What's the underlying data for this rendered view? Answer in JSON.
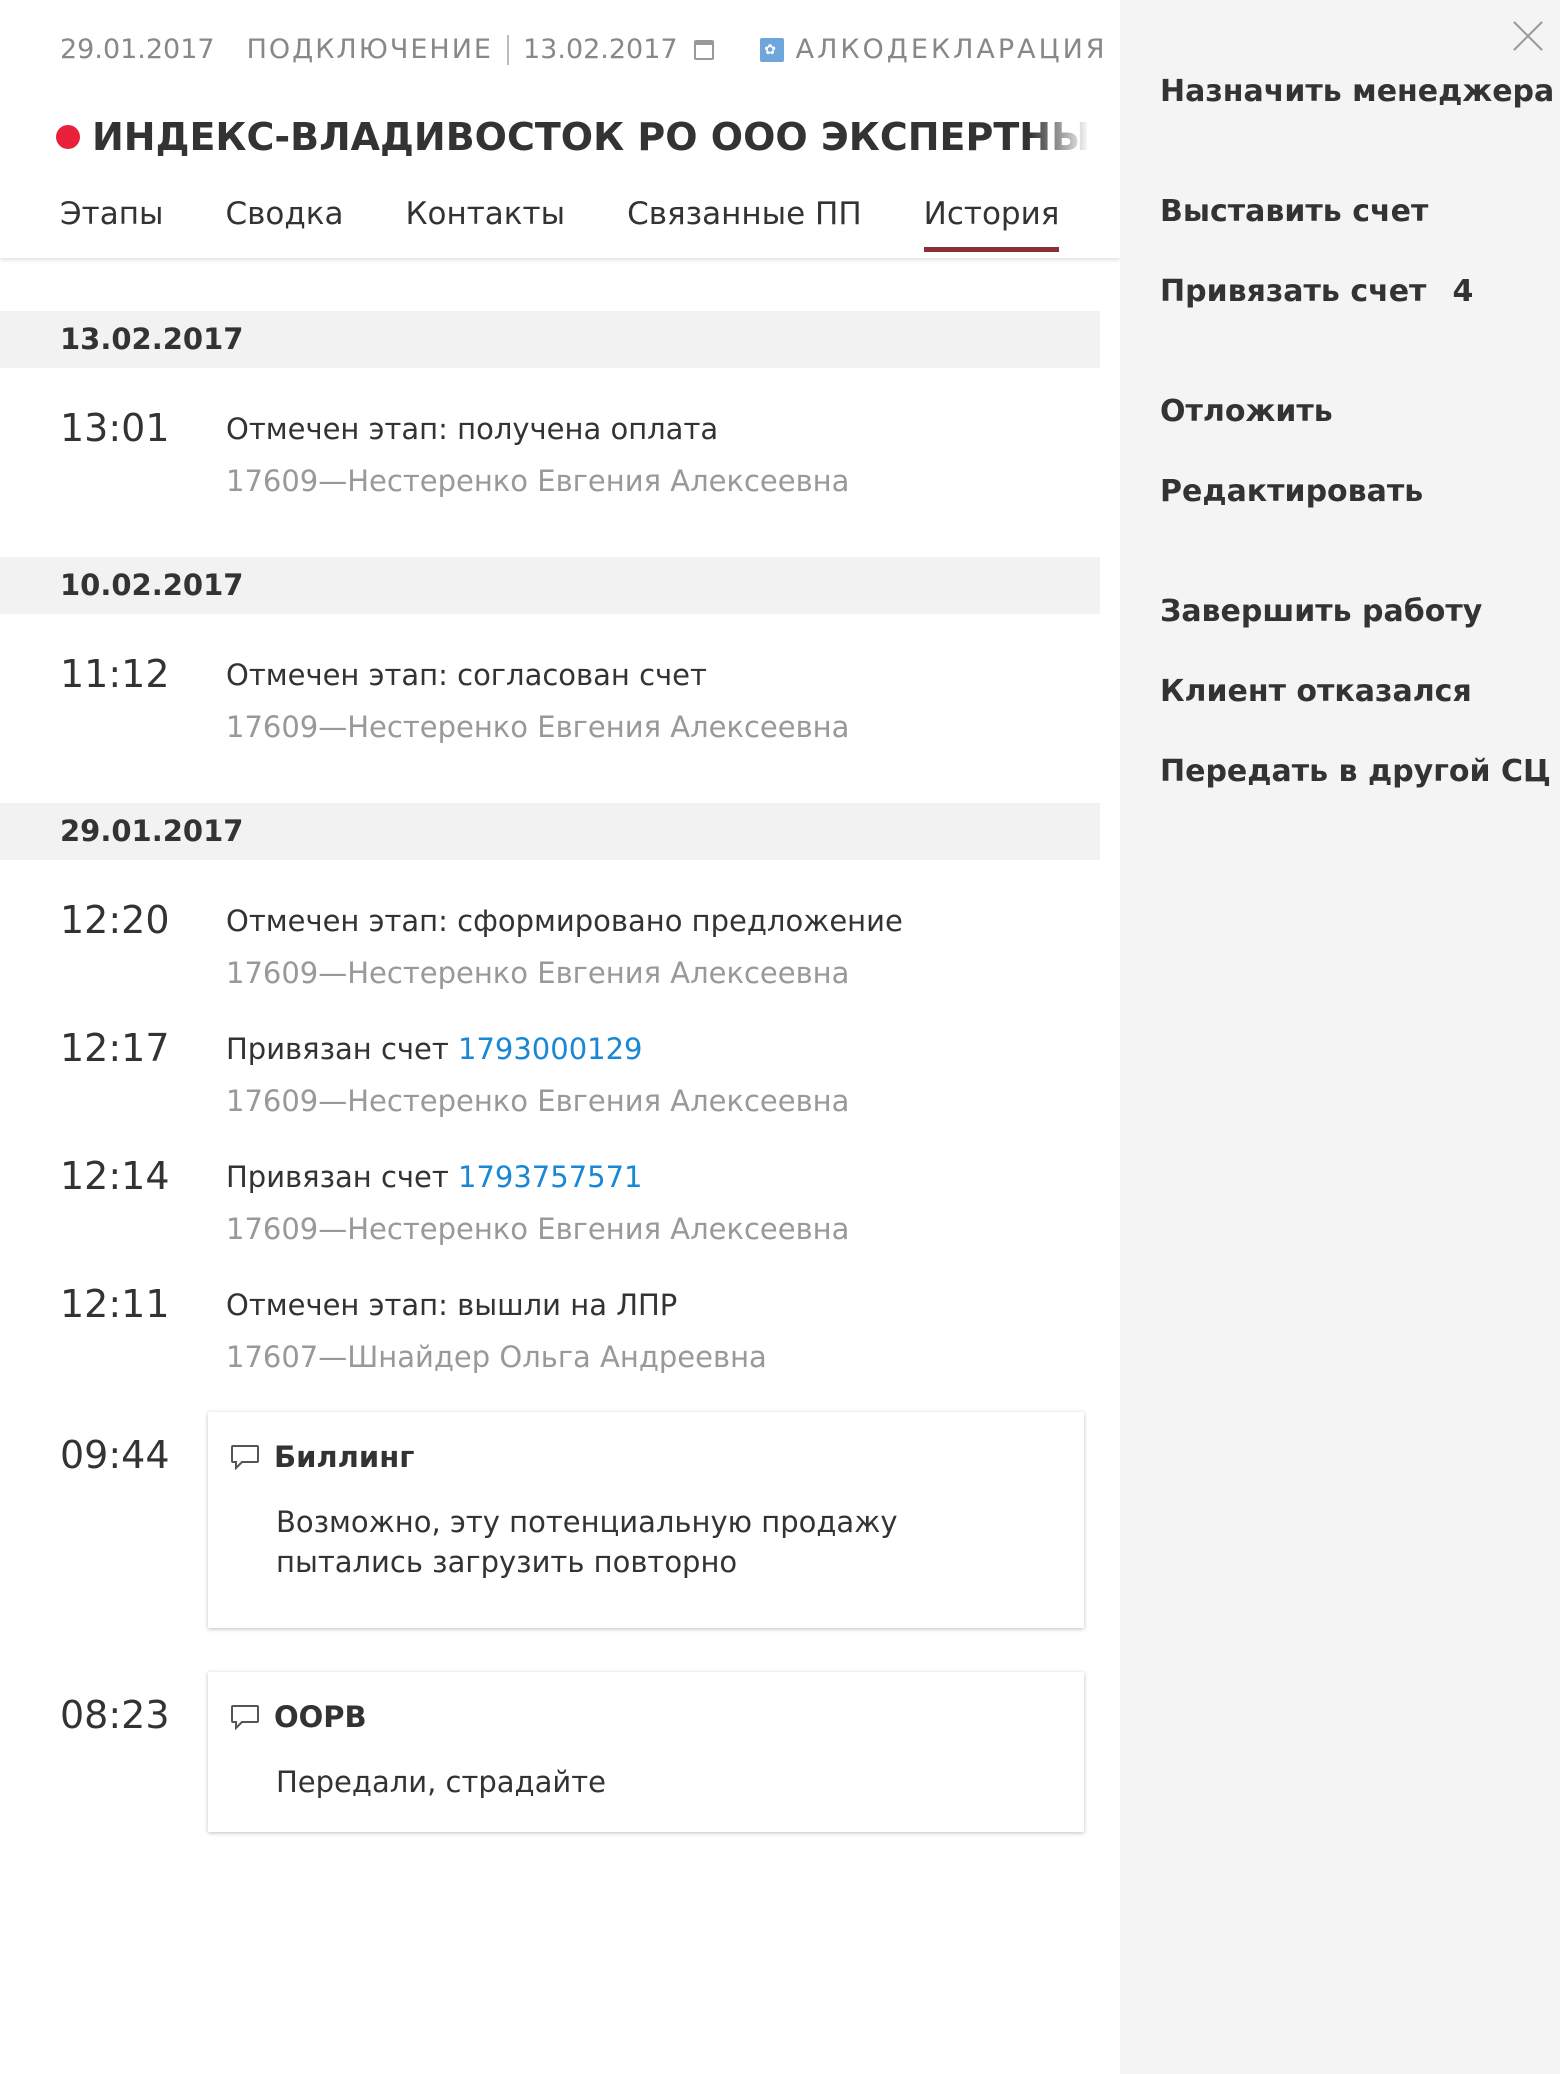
{
  "header": {
    "start_date": "29.01.2017",
    "kind": "ПОДКЛЮЧЕНИЕ",
    "due_date": "13.02.2017",
    "product": "АЛКОДЕКЛАРАЦИЯ",
    "title": "ИНДЕКС-ВЛАДИВОСТОК РО ООО ЭКСПЕРТНЫЙ ЦЕНТР ИНДЕКС",
    "status_color": "#e8203a"
  },
  "tabs": [
    {
      "label": "Этапы"
    },
    {
      "label": "Сводка"
    },
    {
      "label": "Контакты"
    },
    {
      "label": "Связанные ПП"
    },
    {
      "label": "История",
      "active": true
    }
  ],
  "history": {
    "day1": {
      "date": "13.02.2017",
      "e1": {
        "time": "13:01",
        "text": "Отмечен этап: получена оплата",
        "author": "17609—Нестеренко Евгения Алексеевна"
      }
    },
    "day2": {
      "date": "10.02.2017",
      "e1": {
        "time": "11:12",
        "text": "Отмечен этап: согласован счет",
        "author": "17609—Нестеренко Евгения Алексеевна"
      }
    },
    "day3": {
      "date": "29.01.2017",
      "e1": {
        "time": "12:20",
        "text": "Отмечен этап: сформировано предложение",
        "author": "17609—Нестеренко Евгения Алексеевна"
      },
      "e2": {
        "time": "12:17",
        "text": "Привязан счет ",
        "link": "1793000129",
        "author": "17609—Нестеренко Евгения Алексеевна"
      },
      "e3": {
        "time": "12:14",
        "text": "Привязан счет ",
        "link": "1793757571",
        "author": "17609—Нестеренко Евгения Алексеевна"
      },
      "e4": {
        "time": "12:11",
        "text": "Отмечен этап: вышли на ЛПР",
        "author": "17607—Шнайдер Ольга Андреевна"
      },
      "c1": {
        "time": "09:44",
        "title": "Биллинг",
        "body": "Возможно, эту потенциальную продажу\nпытались загрузить повторно"
      },
      "c2": {
        "time": "08:23",
        "title": "ООРВ",
        "body": "Передали, страдайте"
      }
    }
  },
  "actions": {
    "assign_manager": "Назначить менеджера",
    "issue_invoice": "Выставить счет",
    "attach_invoice": "Привязать счет",
    "attach_invoice_count": "4",
    "postpone": "Отложить",
    "edit": "Редактировать",
    "finish": "Завершить работу",
    "client_refused": "Клиент отказался",
    "transfer": "Передать в другой СЦ"
  },
  "colors": {
    "accent_tab": "#8b2f3a",
    "link": "#1a87d5",
    "status_dot": "#e8203a"
  }
}
